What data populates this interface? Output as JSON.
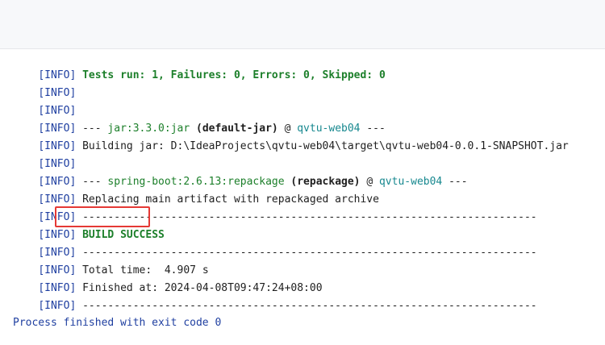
{
  "tag": "INFO",
  "lines": [
    {
      "kind": "tests",
      "text": "Tests run: 1, Failures: 0, Errors: 0, Skipped: 0"
    },
    {
      "kind": "blank"
    },
    {
      "kind": "blank"
    },
    {
      "kind": "plugin",
      "prefix": "--- ",
      "plugin": "jar:3.3.0:jar",
      "goal": "(default-jar)",
      "at": " @ ",
      "module": "qvtu-web04",
      "suffix": " ---"
    },
    {
      "kind": "text",
      "text": "Building jar: D:\\IdeaProjects\\qvtu-web04\\target\\qvtu-web04-0.0.1-SNAPSHOT.jar"
    },
    {
      "kind": "blank"
    },
    {
      "kind": "plugin",
      "prefix": "--- ",
      "plugin": "spring-boot:2.6.13:repackage",
      "goal": "(repackage)",
      "at": " @ ",
      "module": "qvtu-web04",
      "suffix": " ---"
    },
    {
      "kind": "text",
      "text": "Replacing main artifact with repackaged archive"
    },
    {
      "kind": "text",
      "text": "------------------------------------------------------------------------"
    },
    {
      "kind": "success",
      "text": "BUILD SUCCESS"
    },
    {
      "kind": "text",
      "text": "------------------------------------------------------------------------"
    },
    {
      "kind": "text",
      "text": "Total time:  4.907 s"
    },
    {
      "kind": "text",
      "text": "Finished at: 2024-04-08T09:47:24+08:00"
    },
    {
      "kind": "text",
      "text": "------------------------------------------------------------------------"
    }
  ],
  "exit_message": "Process finished with exit code 0",
  "colors": {
    "tag": "#1f3fa0",
    "success": "#1c7f2a",
    "module": "#17888f",
    "highlight_box": "#e53935"
  }
}
